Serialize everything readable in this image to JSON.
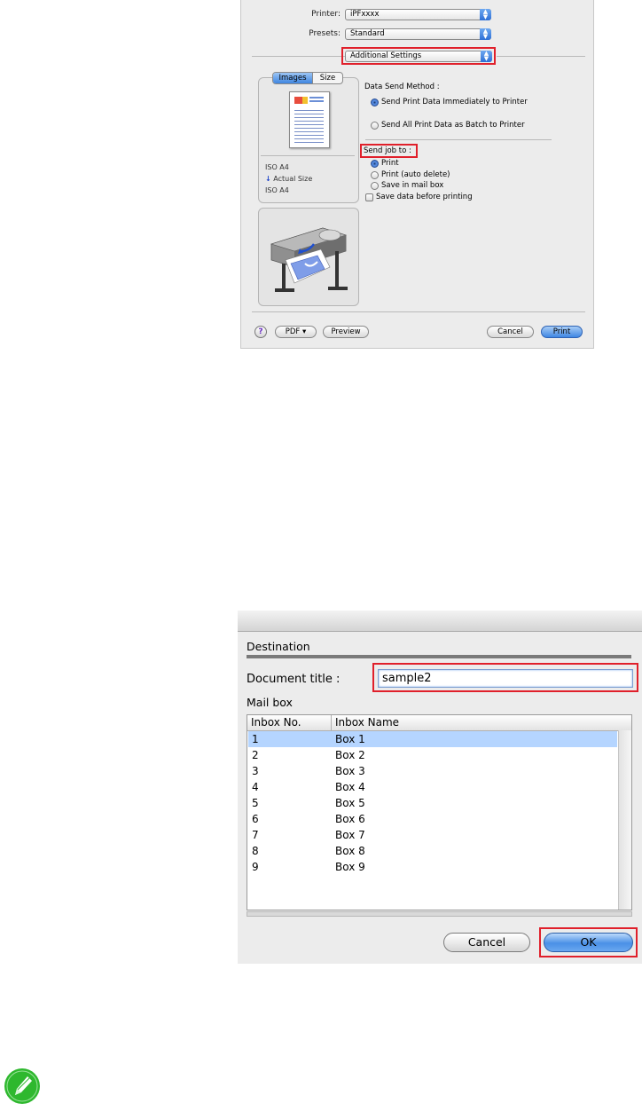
{
  "print_dialog": {
    "printer_label": "Printer:",
    "printer_value": "iPFxxxx",
    "presets_label": "Presets:",
    "presets_value": "Standard",
    "panel_value": "Additional Settings",
    "tabs": [
      "Images",
      "Size"
    ],
    "paper_info": [
      "ISO A4",
      "Actual Size",
      "ISO A4"
    ],
    "data_send_method_label": "Data Send Method :",
    "send_options": [
      {
        "label": "Send Print Data Immediately to Printer",
        "selected": true
      },
      {
        "label": "Send All Print Data as Batch to Printer",
        "selected": false
      }
    ],
    "send_job_label": "Send job to :",
    "job_options": [
      {
        "label": "Print",
        "selected": true
      },
      {
        "label": "Print (auto delete)",
        "selected": false
      },
      {
        "label": "Save in mail box",
        "selected": false
      }
    ],
    "save_before_label": "Save data before printing",
    "help_label": "?",
    "pdf_label": "PDF ▾",
    "preview_label": "Preview",
    "cancel_label": "Cancel",
    "print_label": "Print"
  },
  "destination_dialog": {
    "section_title": "Destination",
    "doc_title_label": "Document title :",
    "doc_title_value": "sample2",
    "mailbox_label": "Mail box",
    "columns": [
      "Inbox No.",
      "Inbox Name"
    ],
    "rows": [
      {
        "no": "1",
        "name": "Box 1"
      },
      {
        "no": "2",
        "name": "Box 2"
      },
      {
        "no": "3",
        "name": "Box 3"
      },
      {
        "no": "4",
        "name": "Box 4"
      },
      {
        "no": "5",
        "name": "Box 5"
      },
      {
        "no": "6",
        "name": "Box 6"
      },
      {
        "no": "7",
        "name": "Box 7"
      },
      {
        "no": "8",
        "name": "Box 8"
      },
      {
        "no": "9",
        "name": "Box 9"
      }
    ],
    "selected_row": 0,
    "cancel_label": "Cancel",
    "ok_label": "OK"
  },
  "colors": {
    "highlight_red": "#e0202b",
    "selected_row": "#b5d5ff",
    "note_icon": "#2eb82e"
  }
}
